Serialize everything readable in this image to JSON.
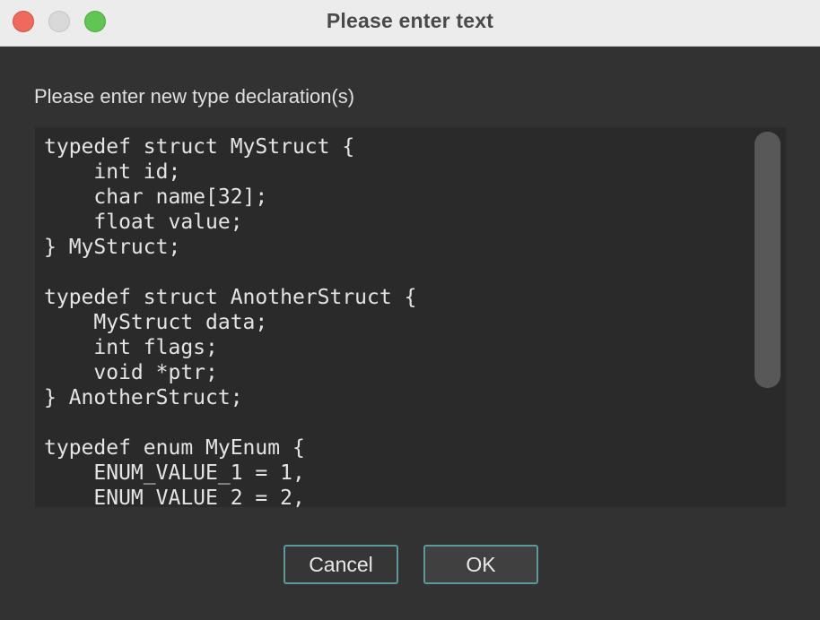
{
  "window": {
    "title": "Please enter text"
  },
  "dialog": {
    "prompt": "Please enter new type declaration(s)",
    "code_lines": [
      "typedef struct MyStruct {",
      "    int id;",
      "    char name[32];",
      "    float value;",
      "} MyStruct;",
      "",
      "typedef struct AnotherStruct {",
      "    MyStruct data;",
      "    int flags;",
      "    void *ptr;",
      "} AnotherStruct;",
      "",
      "typedef enum MyEnum {",
      "    ENUM_VALUE_1 = 1,",
      "    ENUM_VALUE_2 = 2,"
    ],
    "cancel_label": "Cancel",
    "ok_label": "OK"
  },
  "colors": {
    "close": "#ee6a5f",
    "minimize": "#d9d9d9",
    "maximize": "#61c554",
    "button_border": "#5a9a9a"
  }
}
